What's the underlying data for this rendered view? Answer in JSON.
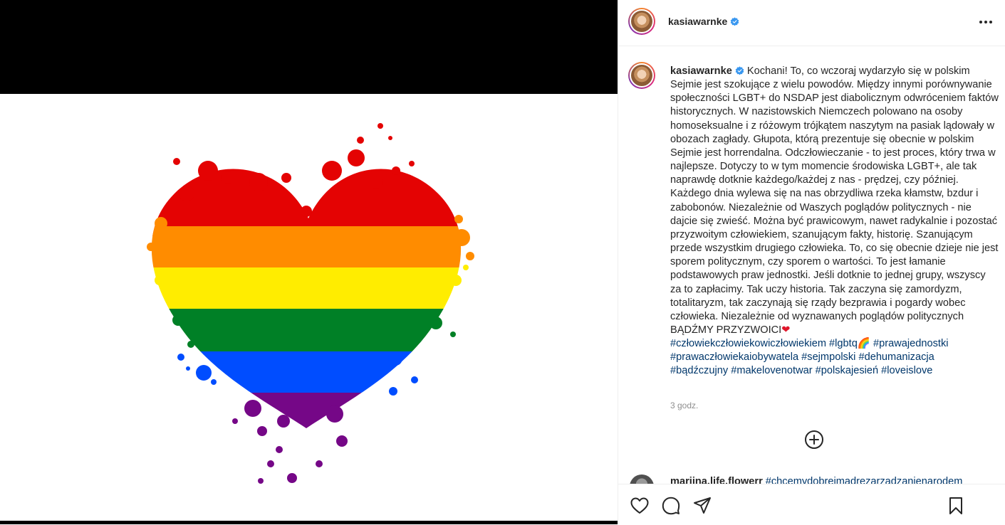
{
  "post": {
    "username": "kasiawarnke",
    "verified": true
  },
  "caption": {
    "username": "kasiawarnke",
    "text": "Kochani! To, co wczoraj wydarzyło się w polskim Sejmie jest szokujące z wielu powodów. Między innymi porównywanie społeczności LGBT+ do NSDAP jest diabolicznym odwróceniem faktów historycznych. W nazistowskich Niemczech polowano na osoby homoseksualne i z różowym trójkątem naszytym na pasiak lądowały w obozach zagłady. Głupota, którą prezentuje się obecnie w polskim Sejmie jest horrendalna. Odczłowieczanie - to jest proces, który trwa w najlepsze. Dotyczy to w tym momencie środowiska LGBT+, ale tak naprawdę dotknie każdego/każdej z nas - prędzej, czy później. Każdego dnia wylewa się na nas obrzydliwa rzeka kłamstw, bzdur i zabobonów. Niezależnie od Waszych poglądów politycznych - nie dajcie się zwieść. Można być prawicowym, nawet radykalnie i pozostać przyzwoitym człowiekiem, szanującym fakty, historię. Szanującym przede wszystkim drugiego człowieka. To, co się obecnie dzieje nie jest sporem politycznym, czy sporem o wartości. To jest łamanie podstawowych praw jednostki. Jeśli dotknie to jednej grupy, wszyscy za to zapłacimy. Tak uczy historia. Tak zaczyna się zamordyzm, totalitaryzm, tak zaczynają się rządy bezprawia i pogardy wobec człowieka. Niezależnie od wyznawanych poglądów politycznych BĄDŹMY PRZYZWOICI",
    "heart_emoji": "❤",
    "hashtag_lines": [
      [
        "#człowiekczłowiekowiczłowiekiem",
        "#lgbtq🌈",
        "#prawajednostki"
      ],
      [
        "#prawaczłowiekaiobywatela",
        "#sejmpolski",
        "#dehumanizacja"
      ],
      [
        "#bądźczujny",
        "#makelovenotwar",
        "#polskajesień",
        "#loveislove"
      ]
    ],
    "timestamp": "3 godz."
  },
  "next_comment": {
    "username": "marijna.life.flowerr",
    "hashtag": "#chcemydobrejmadrezarzadzanienarodem"
  },
  "icons": {
    "more": "more-options-icon",
    "load_more": "add-circle-icon",
    "like": "heart-icon",
    "comment": "comment-icon",
    "share": "send-icon",
    "save": "bookmark-icon"
  },
  "colors": {
    "hashtag": "#00376b",
    "verified": "#3897f0",
    "heart_emoji": "#e0162b",
    "pride_red": "#e40303",
    "pride_orange": "#ff8c00",
    "pride_yellow": "#ffed00",
    "pride_green": "#008026",
    "pride_blue": "#004dff",
    "pride_purple": "#750787"
  }
}
